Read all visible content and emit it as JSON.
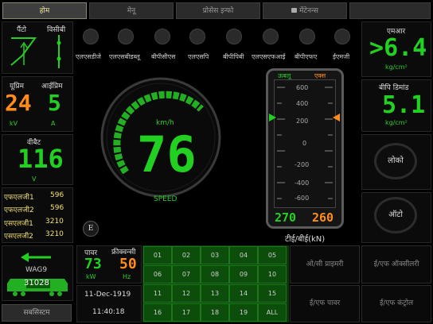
{
  "tabs": [
    {
      "label": "होम"
    },
    {
      "label": "मेनू"
    },
    {
      "label": "प्रोसेस इन्फो"
    },
    {
      "label": "मेंटेनन्स"
    },
    {
      "label": ""
    }
  ],
  "left": {
    "panto_label": "पैंटो",
    "vcb_label": "विसीबी",
    "ucurrent_label": "यूप्रिम",
    "icurrent_label": "आईप्रिम",
    "u_value": "24",
    "i_value": "5",
    "u_unit": "kV",
    "i_unit": "A",
    "vbat_label": "वीबैट",
    "vbat_value": "116",
    "vbat_unit": "V",
    "loads": [
      {
        "name": "एफएलजी1",
        "value": "596"
      },
      {
        "name": "एफएलजी2",
        "value": "596"
      },
      {
        "name": "एसएलजी1",
        "value": "3210"
      },
      {
        "name": "एसएलजी2",
        "value": "3210"
      }
    ],
    "loco_name": "WAG9",
    "loco_number": "31028",
    "subsystem_label": "सबसिस्टम"
  },
  "indicators": [
    "एलएसडीजे",
    "एलएसबीडब्लू",
    "बीपीसीएस",
    "एलएसपि",
    "बीपीपिबी",
    "एलएसएफआई",
    "बीपीएफए",
    "ईएमजी"
  ],
  "speed": {
    "unit": "km/h",
    "value": "76",
    "label": "SPEED",
    "max": 120,
    "fraction": 0.63,
    "e_label": "E"
  },
  "te_gauge": {
    "actual_label": "ऊबलू",
    "set_label": "एक्स",
    "ticks": [
      "600",
      "400",
      "200",
      "0",
      "-200",
      "-400",
      "-600"
    ],
    "actual_value": "270",
    "set_value": "260",
    "caption": "टीई/बीई(kN)"
  },
  "right": {
    "mr_label": "एमआर",
    "mr_value": "6.4",
    "mr_unit": "kg/cm²",
    "bp_label": "बीपि डिमांड",
    "bp_value": "5.1",
    "bp_unit": "kg/cm²",
    "loco_btn": "लोको",
    "auto_btn": "ऑटो"
  },
  "bottom": {
    "power_label": "पावर",
    "freq_label": "फ्रीक्वन्सी",
    "power_value": "73",
    "freq_value": "50",
    "power_unit": "kW",
    "freq_unit": "Hz",
    "date": "11-Dec-1919",
    "time": "11:40:18",
    "grid": [
      "01",
      "02",
      "03",
      "04",
      "05",
      "06",
      "07",
      "08",
      "09",
      "10",
      "11",
      "12",
      "13",
      "14",
      "15",
      "16",
      "17",
      "18",
      "19",
      "ALL"
    ],
    "btn_os_primary": "ओ/सी प्राइमरी",
    "btn_ef_aux": "ई/एफ ऑक्सीलरी",
    "btn_ef_power": "ई/एफ पावर",
    "btn_ef_control": "ई/एफ कंट्रोल"
  },
  "colors": {
    "green": "#22d022",
    "orange": "#ff8c1a",
    "yellow": "#f0e070"
  }
}
